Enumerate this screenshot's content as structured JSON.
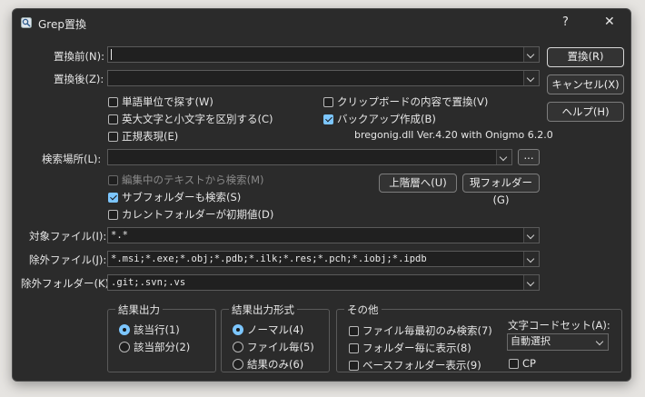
{
  "window": {
    "title": "Grep置換",
    "help": "?",
    "close": "✕"
  },
  "labels": {
    "before": "置換前(N):",
    "after": "置換後(Z):",
    "search_location": "検索場所(L):",
    "target_files": "対象ファイル(I):",
    "exclude_files": "除外ファイル(J):",
    "exclude_folders": "除外フォルダー(K):"
  },
  "fields": {
    "before_value": "",
    "after_value": "",
    "location_value": "",
    "target_files_value": "*.*",
    "exclude_files_value": "*.msi;*.exe;*.obj;*.pdb;*.ilk;*.res;*.pch;*.iobj;*.ipdb",
    "exclude_folders_value": ".git;.svn;.vs"
  },
  "buttons": {
    "replace": "置換(R)",
    "cancel": "キャンセル(X)",
    "help": "ヘルプ(H)",
    "browse": "...",
    "parent": "上階層へ(U)",
    "current": "現フォルダー(G)"
  },
  "options": {
    "word": {
      "label": "単語単位で探す(W)",
      "checked": false
    },
    "case": {
      "label": "英大文字と小文字を区別する(C)",
      "checked": false
    },
    "regex": {
      "label": "正規表現(E)",
      "checked": false
    },
    "clipboard": {
      "label": "クリップボードの内容で置換(V)",
      "checked": false
    },
    "backup": {
      "label": "バックアップ作成(B)",
      "checked": true
    },
    "from_editing": {
      "label": "編集中のテキストから検索(M)",
      "checked": false,
      "disabled": true
    },
    "subfolders": {
      "label": "サブフォルダーも検索(S)",
      "checked": true
    },
    "current_default": {
      "label": "カレントフォルダーが初期値(D)",
      "checked": false
    }
  },
  "version_text": "bregonig.dll Ver.4.20 with Onigmo 6.2.0",
  "result_output": {
    "title": "結果出力",
    "items": [
      {
        "label": "該当行(1)",
        "checked": true
      },
      {
        "label": "該当部分(2)",
        "checked": false
      }
    ]
  },
  "result_format": {
    "title": "結果出力形式",
    "items": [
      {
        "label": "ノーマル(4)",
        "checked": true
      },
      {
        "label": "ファイル毎(5)",
        "checked": false
      },
      {
        "label": "結果のみ(6)",
        "checked": false
      }
    ]
  },
  "other": {
    "title": "その他",
    "items": [
      {
        "label": "ファイル毎最初のみ検索(7)",
        "checked": false
      },
      {
        "label": "フォルダー毎に表示(8)",
        "checked": false
      },
      {
        "label": "ベースフォルダー表示(9)",
        "checked": false
      }
    ],
    "charset_label": "文字コードセット(A):",
    "charset_value": "自動選択",
    "cp_label": "CP",
    "cp_checked": false
  }
}
